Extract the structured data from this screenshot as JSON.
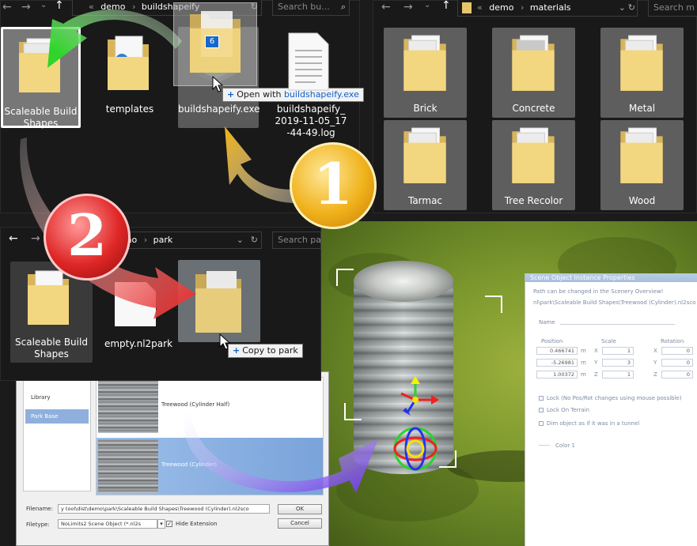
{
  "explorer_top": {
    "breadcrumb": [
      "demo",
      "buildshapeify"
    ],
    "search_placeholder": "Search bu...",
    "items": [
      {
        "label": "Scaleable Build Shapes",
        "icon": "folder-icon"
      },
      {
        "label": "templates",
        "icon": "folder-icon"
      },
      {
        "label": "buildshapeify.exe",
        "icon": "exe-icon"
      },
      {
        "label": "buildshapeify_2019-11-05_17-44-49.log",
        "icon": "log-file-icon"
      }
    ],
    "drag_count": "6",
    "drop_tooltip_action": "Open with",
    "drop_tooltip_target": "buildshapeify.exe"
  },
  "explorer_materials": {
    "breadcrumb": [
      "demo",
      "materials"
    ],
    "search_placeholder": "Search m",
    "folders": [
      "Brick",
      "Concrete",
      "Metal",
      "Tarmac",
      "Tree Recolor",
      "Wood"
    ]
  },
  "explorer_park": {
    "breadcrumb": [
      "demo",
      "park"
    ],
    "search_placeholder": "Search pa",
    "items": [
      {
        "label": "Scaleable Build Shapes",
        "icon": "folder-icon"
      },
      {
        "label": "empty.nl2park",
        "icon": "file-icon"
      }
    ],
    "drop_tooltip_action": "Copy to park"
  },
  "steps": {
    "one": "1",
    "two": "2"
  },
  "library_dialog": {
    "sidebar": [
      "Library",
      "Park Base"
    ],
    "objects": [
      "Treewood (Cylinder Half)",
      "Treewood (Cylinder)"
    ],
    "filename_label": "Filename:",
    "filename_value": "y tool\\dist\\demo\\park\\Scaleable Build Shapes\\Treewood (Cylinder).nl2sco",
    "filetype_label": "Filetype:",
    "filetype_value": "NoLimits2 Scene Object (*.nl2s",
    "hide_extension": "Hide Extension",
    "ok": "OK",
    "cancel": "Cancel"
  },
  "properties": {
    "title": "Scene Object Instance Properties",
    "note": "Path can be changed in the Scenery Overview!",
    "path": "nl\\park\\Scaleable Build Shapes\\Treewood (Cylinder).nl2sco",
    "name_label": "Name",
    "position_label": "Position",
    "scale_label": "Scale",
    "rotation_label": "Rotation",
    "position": [
      "0.466741",
      "-5.26981",
      "1.00372"
    ],
    "position_unit": "m",
    "scale_axes": [
      "X",
      "Y",
      "Z"
    ],
    "scale": [
      "1",
      "3",
      "1"
    ],
    "rotation_axes": [
      "X",
      "Y",
      "Z"
    ],
    "rotation": [
      "0",
      "0",
      "0"
    ],
    "lock_text": "Lock (No Pos/Rot changes using mouse possible)",
    "terrain_text": "Lock On Terrain",
    "tunnel_text": "Dim object as if it was in a tunnel",
    "color_label": "Color 1"
  },
  "colors": {
    "arrow_green": "#33d62a",
    "arrow_yellow": "#f2b51a",
    "arrow_red": "#e02727",
    "arrow_purple": "#7a3fe0",
    "explorer_bg": "#191919",
    "selected_tile": "#777777"
  }
}
